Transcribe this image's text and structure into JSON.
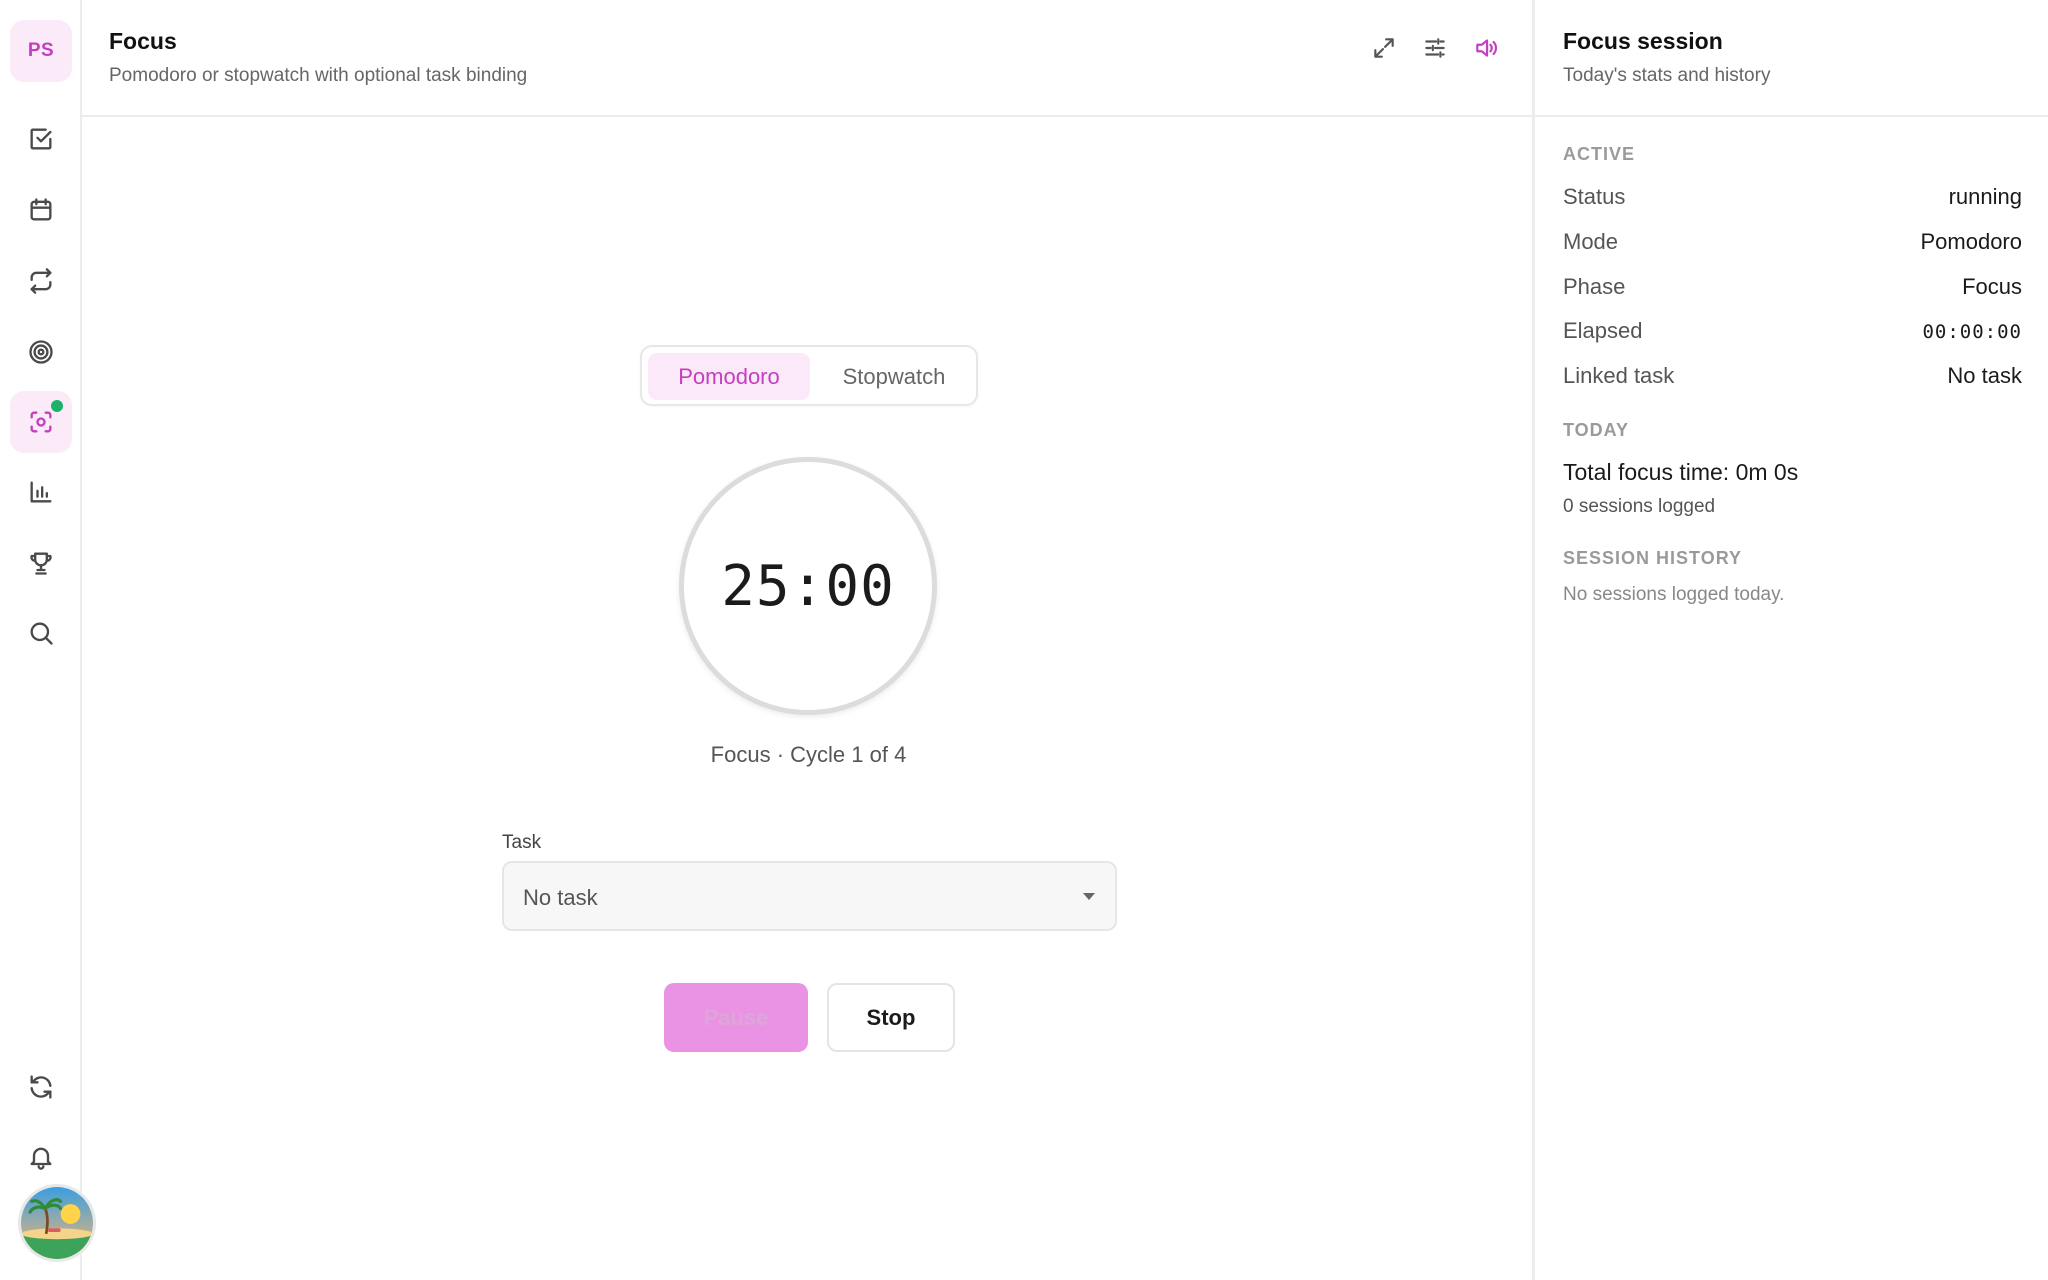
{
  "rail": {
    "profile_initials": "PS",
    "items": [
      {
        "name": "tasks",
        "icon": "checkbox-icon"
      },
      {
        "name": "calendar",
        "icon": "calendar-icon"
      },
      {
        "name": "habits",
        "icon": "repeat-icon"
      },
      {
        "name": "goals",
        "icon": "target-icon"
      },
      {
        "name": "focus",
        "icon": "focus-icon",
        "active": true
      },
      {
        "name": "stats",
        "icon": "bar-chart-icon"
      },
      {
        "name": "achievements",
        "icon": "trophy-icon"
      },
      {
        "name": "search",
        "icon": "search-icon"
      }
    ],
    "bottom": [
      {
        "name": "sync",
        "icon": "sync-icon"
      },
      {
        "name": "notifications",
        "icon": "bell-icon"
      }
    ]
  },
  "header": {
    "title": "Focus",
    "subtitle": "Pomodoro or stopwatch with optional task binding"
  },
  "mode": {
    "options": [
      "Pomodoro",
      "Stopwatch"
    ],
    "selected": "Pomodoro"
  },
  "timer": {
    "display": "25:00",
    "cycle_label": "Focus · Cycle 1 of 4"
  },
  "task": {
    "label": "Task",
    "value": "No task"
  },
  "actions": {
    "pause_label": "Pause",
    "stop_label": "Stop"
  },
  "side": {
    "title": "Focus session",
    "subtitle": "Today's stats and history",
    "active_heading": "ACTIVE",
    "rows": [
      {
        "key": "Status",
        "value": "running"
      },
      {
        "key": "Mode",
        "value": "Pomodoro"
      },
      {
        "key": "Phase",
        "value": "Focus"
      },
      {
        "key": "Elapsed",
        "value": "00:00:00"
      },
      {
        "key": "Linked task",
        "value": "No task"
      }
    ],
    "today_heading": "TODAY",
    "total_focus": "Total focus time: 0m 0s",
    "sessions_logged": "0 sessions logged",
    "history_heading": "SESSION HISTORY",
    "history_empty": "No sessions logged today."
  },
  "colors": {
    "accent": "#c43fc0",
    "accent_bg": "#fbeaf8",
    "online": "#1db26b"
  }
}
